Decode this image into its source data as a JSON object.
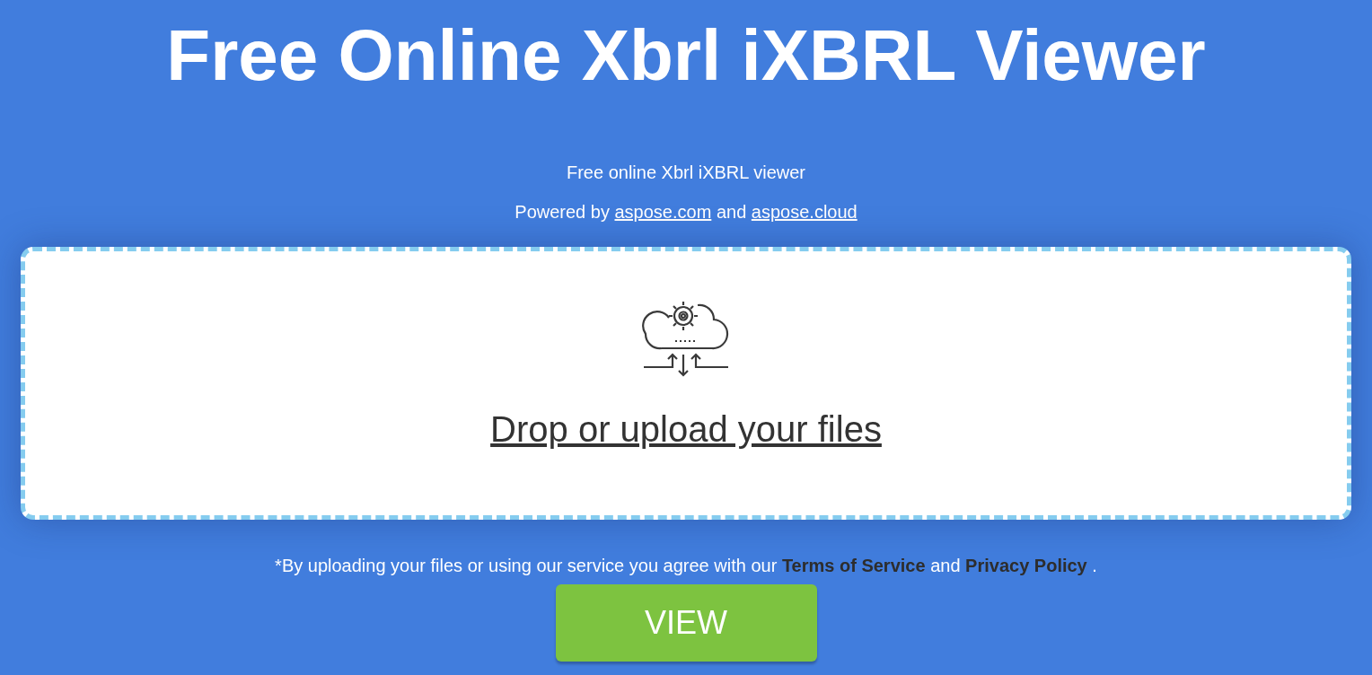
{
  "title": "Free Online Xbrl iXBRL Viewer",
  "subtitle": "Free online Xbrl iXBRL viewer",
  "powered_by": [
    {
      "kind": "text",
      "text": "Powered by"
    },
    {
      "kind": "link",
      "text": "aspose.com"
    },
    {
      "kind": "text",
      "text": "and"
    },
    {
      "kind": "link",
      "text": "aspose.cloud"
    }
  ],
  "dropzone": {
    "label": "Drop or upload your files"
  },
  "terms": [
    {
      "kind": "text",
      "text": "*By uploading your files or using our service you agree with our"
    },
    {
      "kind": "link",
      "text": "Terms of Service"
    },
    {
      "kind": "text",
      "text": "and"
    },
    {
      "kind": "link",
      "text": "Privacy Policy"
    },
    {
      "kind": "text",
      "text": "."
    }
  ],
  "button": "VIEW"
}
